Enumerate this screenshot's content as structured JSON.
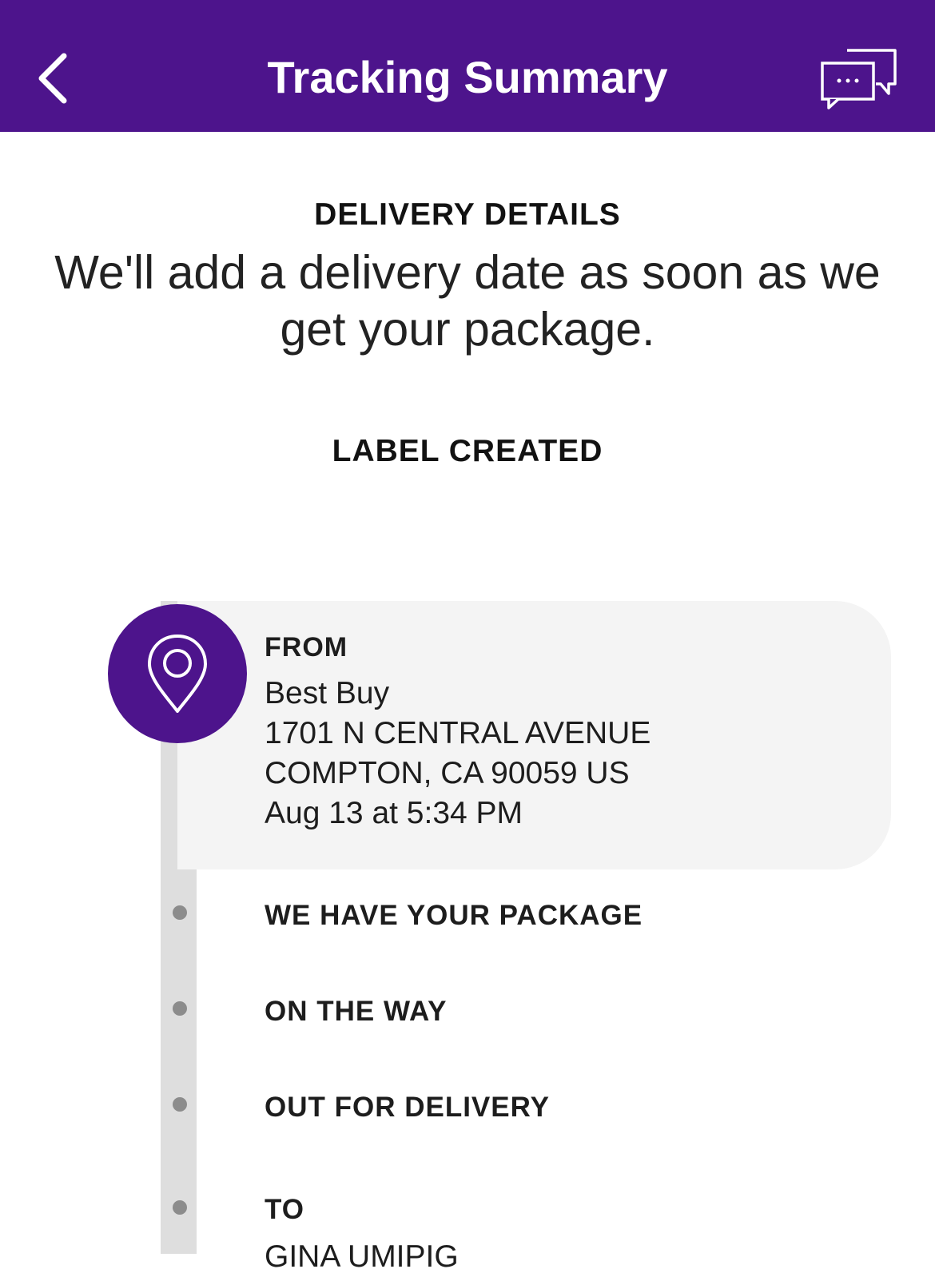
{
  "header": {
    "title": "Tracking Summary",
    "background_color": "#4d148c",
    "back_icon": "chevron-left-icon",
    "chat_icon": "chat-bubbles-icon"
  },
  "delivery": {
    "heading": "DELIVERY DETAILS",
    "message": "We'll add a delivery date as soon as we get your package."
  },
  "status": {
    "heading": "LABEL CREATED"
  },
  "timeline": {
    "from": {
      "label": "FROM",
      "name": "Best Buy",
      "address_line1": "1701 N CENTRAL AVENUE",
      "address_line2": "COMPTON, CA 90059 US",
      "datetime": "Aug 13 at 5:34 PM",
      "icon": "location-pin-icon"
    },
    "steps": [
      {
        "label": "WE HAVE YOUR PACKAGE"
      },
      {
        "label": "ON THE WAY"
      },
      {
        "label": "OUT FOR DELIVERY"
      }
    ],
    "to": {
      "label": "TO",
      "name": "GINA UMIPIG"
    }
  }
}
